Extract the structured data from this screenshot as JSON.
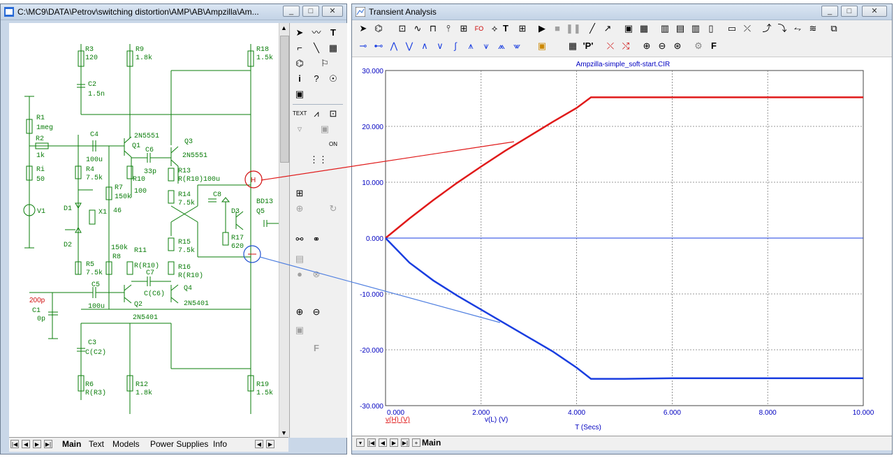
{
  "schematic_window": {
    "title": "C:\\MC9\\DATA\\Petrov\\switching distortion\\AMP\\AB\\Ampzilla\\Am...",
    "tabs": [
      "Main",
      "Text",
      "Models",
      "Power Supplies",
      "Info"
    ],
    "components": {
      "r3": [
        "R3",
        "120"
      ],
      "r9": [
        "R9",
        "1.8k"
      ],
      "r18": [
        "R18",
        "1.5k"
      ],
      "c2": [
        "C2",
        "1.5n"
      ],
      "r1": [
        "R1",
        "1meg"
      ],
      "r2": [
        "R2",
        "1k"
      ],
      "ri": [
        "Ri",
        "50"
      ],
      "v1": "V1",
      "c4": [
        "C4",
        "100u"
      ],
      "q1": [
        "2N5551",
        "Q1"
      ],
      "q3": [
        "Q3",
        "2N5551"
      ],
      "c6": [
        "C6",
        "33p"
      ],
      "r4": [
        "R4",
        "7.5k"
      ],
      "r10": [
        "R10",
        "100"
      ],
      "r13": [
        "R13",
        "R(R10)"
      ],
      "r100u": "100u",
      "r7": [
        "R7",
        "150k"
      ],
      "x1": [
        "X1",
        "46"
      ],
      "r14": [
        "R14",
        "7.5k"
      ],
      "c8": "C8",
      "d1": "D1",
      "d2": "D2",
      "d3": "D3",
      "bd13": "BD13",
      "q5": "Q5",
      "r17": [
        "R17",
        "620"
      ],
      "r15": [
        "R15",
        "7.5k"
      ],
      "r8": [
        "150k",
        "R8"
      ],
      "r11": [
        "R11",
        "R(R10)"
      ],
      "r5": [
        "R5",
        "7.5k"
      ],
      "c7": [
        "C7",
        "C(C6)"
      ],
      "r16": [
        "R16",
        "R(R10)"
      ],
      "q4": [
        "Q4",
        "2N5401"
      ],
      "c5": [
        "C5",
        "100u"
      ],
      "q2": "Q2",
      "c1": [
        "200p",
        "C1",
        "0p"
      ],
      "q2type": "2N5401",
      "c3": [
        "C3",
        "C(C2)"
      ],
      "r6": [
        "R6",
        "R(R3)"
      ],
      "r12": [
        "R12",
        "1.8k"
      ],
      "r19": [
        "R19",
        "1.5k"
      ],
      "node_h": "H"
    }
  },
  "palette_tools": [
    "select-arrow-icon",
    "wire-icon",
    "text-tool-icon",
    "orthogonal-wire-icon",
    "diagonal-wire-icon",
    "flag-icon",
    "component-icon",
    "flag-tool-icon",
    "info-icon",
    "help-icon",
    "point-icon",
    "color-icon",
    "text-mode-icon",
    "attribute-icon",
    "pin-icon",
    "node-voltage-icon",
    "current-icon",
    "onoff-icon",
    "grid-icon",
    "zoom-in-icon",
    "zoom-out-icon",
    "find-icon",
    "properties-icon"
  ],
  "analysis_window": {
    "title": "Transient Analysis",
    "tab": "Main",
    "chart_title": "Ampzilla-simple_soft-start.CIR"
  },
  "colors": {
    "red_trace": "#e01a1a",
    "blue_trace": "#1a3ee0",
    "wire_green": "#0a7d0a",
    "axis_blue": "#0000c0"
  },
  "chart_data": {
    "type": "line",
    "title": "Ampzilla-simple_soft-start.CIR",
    "xlabel": "T (Secs)",
    "ylabel": "",
    "xlim": [
      0,
      10
    ],
    "ylim": [
      -30,
      30
    ],
    "x_ticks": [
      "0.000",
      "2.000",
      "4.000",
      "6.000",
      "8.000",
      "10.000"
    ],
    "y_ticks": [
      "30.000",
      "20.000",
      "10.000",
      "0.000",
      "-10.000",
      "-20.000",
      "-30.000"
    ],
    "grid": true,
    "series": [
      {
        "name": "v(H) (V)",
        "color": "#e01a1a",
        "x": [
          0,
          0.5,
          1.0,
          1.5,
          2.0,
          2.5,
          3.0,
          3.5,
          4.0,
          4.3,
          5,
          6,
          7,
          8,
          9,
          10
        ],
        "y": [
          0,
          3.5,
          6.8,
          9.9,
          12.8,
          15.6,
          18.2,
          20.8,
          23.3,
          25.2,
          25.2,
          25.2,
          25.2,
          25.2,
          25.2,
          25.2
        ]
      },
      {
        "name": "v(L) (V)",
        "color": "#1a3ee0",
        "x": [
          0,
          0.5,
          1.0,
          1.5,
          2.0,
          2.5,
          3.0,
          3.5,
          4.0,
          4.3,
          5,
          6,
          7,
          8,
          9,
          10
        ],
        "y": [
          0,
          -4.4,
          -7.6,
          -10.3,
          -12.8,
          -15.3,
          -17.8,
          -20.3,
          -23.2,
          -25.2,
          -25.2,
          -25.1,
          -25.1,
          -25.1,
          -25.1,
          -25.1
        ]
      },
      {
        "name": "",
        "color": "#1a3ee0",
        "x": [
          0,
          10
        ],
        "y": [
          0,
          0
        ]
      }
    ]
  }
}
